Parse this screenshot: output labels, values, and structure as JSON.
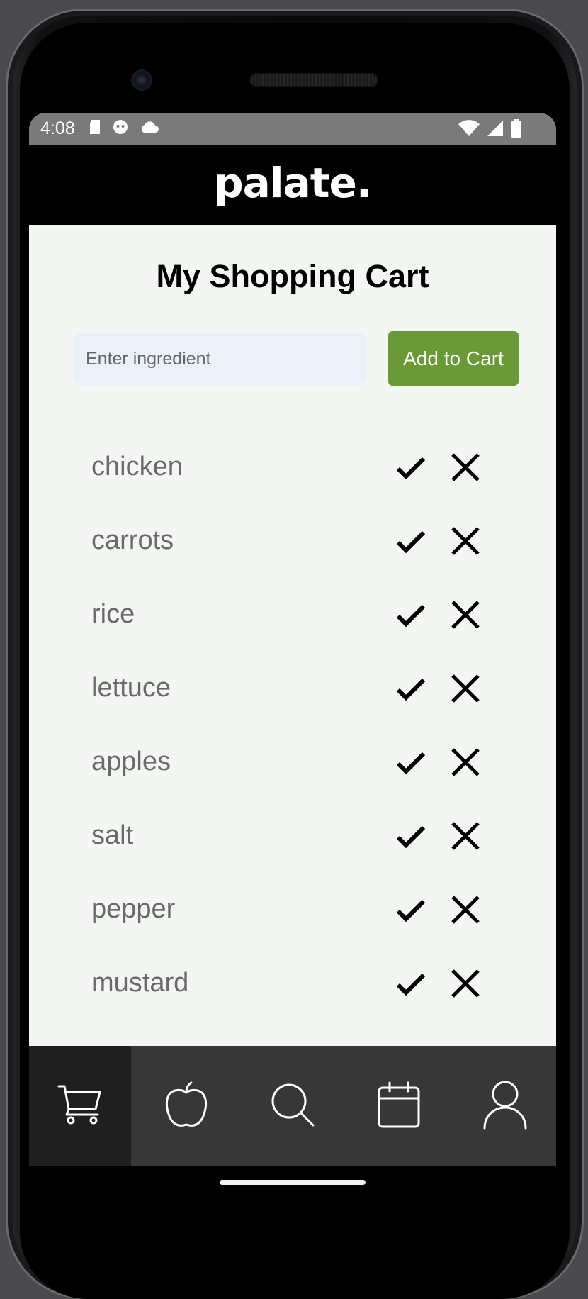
{
  "status_bar": {
    "time": "4:08"
  },
  "app": {
    "logo": "palate."
  },
  "page": {
    "title": "My Shopping Cart"
  },
  "add_form": {
    "placeholder": "Enter ingredient",
    "button_label": "Add to Cart"
  },
  "cart": {
    "items": [
      "chicken",
      "carrots",
      "rice",
      "lettuce",
      "apples",
      "salt",
      "pepper",
      "mustard"
    ]
  },
  "nav": {
    "items": [
      "cart-icon",
      "apple-icon",
      "search-icon",
      "calendar-icon",
      "profile-icon"
    ],
    "active": "cart-icon"
  },
  "colors": {
    "accent": "#6a9a35",
    "header_bg": "#000000",
    "nav_bg": "#373737",
    "nav_active_bg": "#1f1f1f",
    "input_bg": "#eaf1f9"
  }
}
